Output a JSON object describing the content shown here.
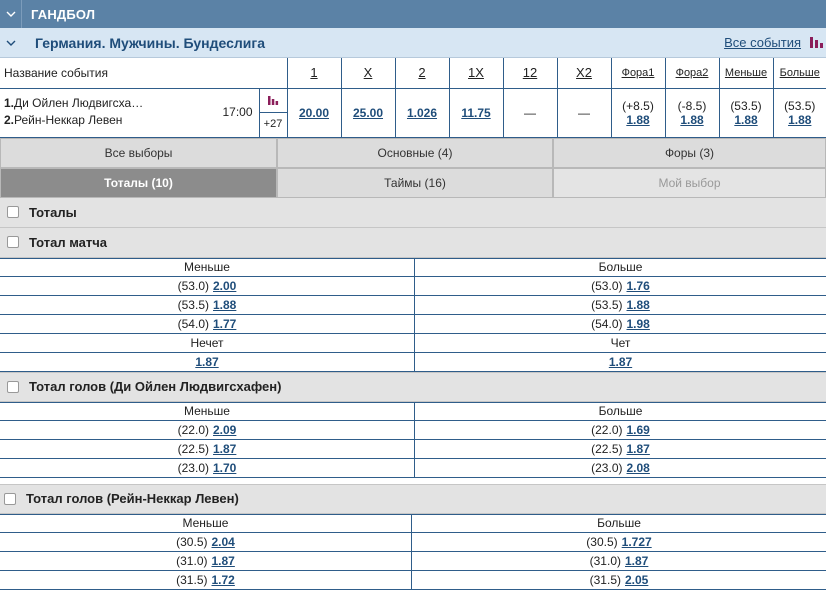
{
  "sport": {
    "title": "ГАНДБОЛ"
  },
  "league": {
    "title": "Германия. Мужчины. Бундеслига",
    "all_events": "Все события"
  },
  "columns": [
    "Название события",
    "1",
    "X",
    "2",
    "1X",
    "12",
    "X2",
    "Фора1",
    "Фора2",
    "Меньше",
    "Больше"
  ],
  "event": {
    "team1_num": "1.",
    "team1": "Ди Ойлен Людвигсха…",
    "team2_num": "2.",
    "team2": "Рейн-Неккар Левен",
    "time": "17:00",
    "more": "+27",
    "odds": [
      "20.00",
      "25.00",
      "1.026",
      "11.75",
      "—",
      "—"
    ],
    "hcp": [
      {
        "line": "(+8.5)",
        "odd": "1.88"
      },
      {
        "line": "(-8.5)",
        "odd": "1.88"
      },
      {
        "line": "(53.5)",
        "odd": "1.88"
      },
      {
        "line": "(53.5)",
        "odd": "1.88"
      }
    ]
  },
  "tabs": [
    {
      "label": "Все выборы",
      "state": "normal"
    },
    {
      "label": "Основные (4)",
      "state": "normal"
    },
    {
      "label": "Форы (3)",
      "state": "normal"
    },
    {
      "label": "Тоталы (10)",
      "state": "active"
    },
    {
      "label": "Таймы (16)",
      "state": "normal"
    },
    {
      "label": "Мой выбор",
      "state": "disabled"
    }
  ],
  "groups": {
    "totals": "Тоталы",
    "match": {
      "title": "Тотал матча",
      "h_under": "Меньше",
      "h_over": "Больше",
      "rows": [
        {
          "ul": "(53.0)",
          "uo": "2.00",
          "ol": "(53.0)",
          "oo": "1.76"
        },
        {
          "ul": "(53.5)",
          "uo": "1.88",
          "ol": "(53.5)",
          "oo": "1.88"
        },
        {
          "ul": "(54.0)",
          "uo": "1.77",
          "ol": "(54.0)",
          "oo": "1.98"
        }
      ],
      "h_odd": "Нечет",
      "h_even": "Чет",
      "odd_val": "1.87",
      "even_val": "1.87"
    },
    "team1": {
      "title": "Тотал голов (Ди Ойлен Людвигсхафен)",
      "h_under": "Меньше",
      "h_over": "Больше",
      "rows": [
        {
          "ul": "(22.0)",
          "uo": "2.09",
          "ol": "(22.0)",
          "oo": "1.69"
        },
        {
          "ul": "(22.5)",
          "uo": "1.87",
          "ol": "(22.5)",
          "oo": "1.87"
        },
        {
          "ul": "(23.0)",
          "uo": "1.70",
          "ol": "(23.0)",
          "oo": "2.08"
        }
      ]
    },
    "team2": {
      "title": "Тотал голов (Рейн-Неккар Левен)",
      "h_under": "Меньше",
      "h_over": "Больше",
      "rows": [
        {
          "ul": "(30.5)",
          "uo": "2.04",
          "ol": "(30.5)",
          "oo": "1.727"
        },
        {
          "ul": "(31.0)",
          "uo": "1.87",
          "ol": "(31.0)",
          "oo": "1.87"
        },
        {
          "ul": "(31.5)",
          "uo": "1.72",
          "ol": "(31.5)",
          "oo": "2.05"
        }
      ]
    }
  },
  "colors": {
    "header": "#5b82a6",
    "league": "#d7e6f3",
    "link": "#1f4d7a",
    "stats_icon": "#8b1e5a"
  }
}
